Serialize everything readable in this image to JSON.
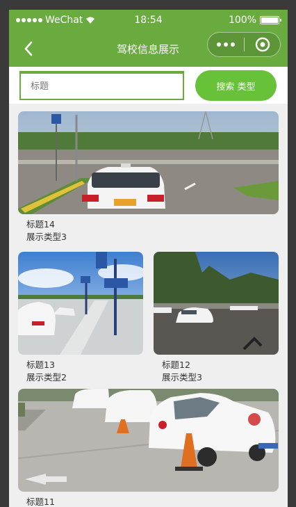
{
  "status": {
    "carrier": "WeChat",
    "time": "18:54",
    "battery": "100%"
  },
  "nav": {
    "title": "驾校信息展示"
  },
  "search": {
    "placeholder": "标题",
    "button_label": "搜索  类型"
  },
  "items": [
    {
      "title": "标题14",
      "type": "展示类型3"
    },
    {
      "title": "标题13",
      "type": "展示类型2"
    },
    {
      "title": "标题12",
      "type": "展示类型3"
    },
    {
      "title": "标题11",
      "type": ""
    }
  ],
  "colors": {
    "brand": "#6aab40",
    "button": "#67c23a"
  }
}
